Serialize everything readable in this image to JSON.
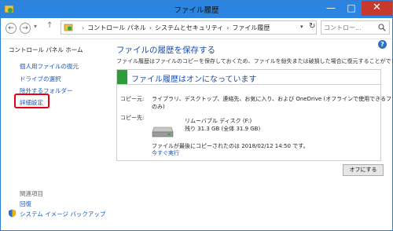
{
  "window": {
    "title": "ファイル履歴"
  },
  "window_controls": {
    "minimize": "—",
    "maximize": "□",
    "close": "✕"
  },
  "nav": {
    "back": "←",
    "forward": "→",
    "recent": "▾",
    "up": "↑"
  },
  "breadcrumbs": [
    "コントロール パネル",
    "システムとセキュリティ",
    "ファイル履歴"
  ],
  "breadcrumb_sep": "›",
  "address_dropdown": "▾",
  "refresh": "↻",
  "search": {
    "placeholder": "コントロー..."
  },
  "help": "?",
  "sidebar": {
    "home": "コントロール パネル ホーム",
    "links": [
      "個人用ファイルの復元",
      "ドライブの選択",
      "除外するフォルダー",
      "詳細設定"
    ],
    "related_header": "関連項目",
    "related": [
      "回復",
      "システム イメージ バックアップ"
    ]
  },
  "main": {
    "title": "ファイルの履歴を保存する",
    "description": "ファイル履歴はファイルのコピーを保存しておくため、ファイルを紛失または破損した場合に復元することができます。",
    "status_title": "ファイル履歴はオンになっています",
    "copy_from_label": "コピー元:",
    "copy_from_line1": "ライブラリ、デスクトップ、連絡先、お気に入り、および OneDrive (オフラインで使用できるファイル",
    "copy_from_line2": "のみ)",
    "copy_to_label": "コピー先:",
    "drive_name": "リムーバブル ディスク (F:)",
    "drive_space": "残り 31.3 GB (全体 31.9 GB)",
    "last_copied": "ファイルが最後にコピーされたのは 2018/02/12 14:50 です。",
    "run_now": "今すぐ実行",
    "off_button": "オフにする"
  },
  "colors": {
    "titlebar": "#2b84e0",
    "link": "#1a55b8",
    "heading": "#1e4ea8",
    "status_flag": "#2d9e37",
    "highlight": "#e60012"
  }
}
